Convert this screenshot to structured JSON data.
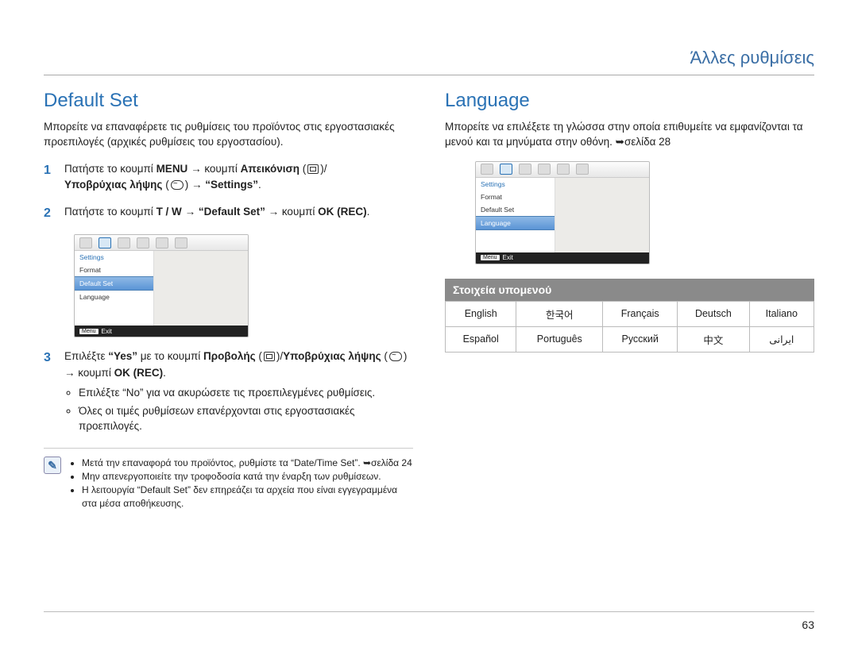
{
  "header": {
    "title": "Άλλες ρυθμίσεις"
  },
  "page_number": "63",
  "left": {
    "heading": "Default Set",
    "intro": "Μπορείτε να επαναφέρετε τις ρυθμίσεις του προϊόντος στις εργοστασιακές προεπιλογές (αρχικές ρυθμίσεις του εργοστασίου).",
    "step1_a": "Πατήστε το κουμπί ",
    "step1_menu": "MENU",
    "step1_arrow": " → κουμπί ",
    "step1_b": "Απεικόνιση",
    "step1_c": "Υποβρύχιας λήψης",
    "step1_d": " → ",
    "step1_e": "“Settings”",
    "step1_dot": ".",
    "step2_a": "Πατήστε το κουμπί ",
    "step2_tw": "T / W",
    "step2_arrow1": " → ",
    "step2_ds": "“Default Set”",
    "step2_arrow2": " → κουμπί ",
    "step2_ok": "OK (REC)",
    "step2_dot": ".",
    "device": {
      "section": "Settings",
      "items": [
        "Format",
        "Default Set",
        "Language"
      ],
      "highlight_index": 1,
      "footer_key": "Menu",
      "footer_label": "Exit"
    },
    "step3_a": "Επιλέξτε ",
    "step3_yes": "“Yes”",
    "step3_b": " με το κουμπί ",
    "step3_c": "Προβολής",
    "step3_d": "Υποβρύχιας λήψης",
    "step3_e": " → κουμπί ",
    "step3_ok": "OK (REC)",
    "step3_dot": ".",
    "bullets": [
      "Επιλέξτε “No” για να ακυρώσετε τις προεπιλεγμένες ρυθμίσεις.",
      "Όλες οι τιμές ρυθμίσεων επανέρχονται στις εργοστασιακές προεπιλογές."
    ],
    "note": {
      "items": [
        "Μετά την επαναφορά του προϊόντος, ρυθμίστε τα “Date/Time Set”. ➥σελίδα 24",
        "Μην απενεργοποιείτε την τροφοδοσία κατά την έναρξη των ρυθμίσεων.",
        "Η λειτουργία “Default Set” δεν επηρεάζει τα αρχεία που είναι εγγεγραμμένα στα μέσα αποθήκευσης."
      ]
    }
  },
  "right": {
    "heading": "Language",
    "intro": "Μπορείτε να επιλέξετε τη γλώσσα στην οποία επιθυμείτε να εμφανίζονται τα μενού και τα μηνύματα στην οθόνη. ➥σελίδα 28",
    "device": {
      "section": "Settings",
      "items": [
        "Format",
        "Default Set",
        "Language"
      ],
      "highlight_index": 2,
      "footer_key": "Menu",
      "footer_label": "Exit"
    },
    "submenu_title": "Στοιχεία υπομενού",
    "languages": [
      [
        "English",
        "한국어",
        "Français",
        "Deutsch",
        "Italiano"
      ],
      [
        "Español",
        "Português",
        "Русский",
        "中文",
        "ایرانی"
      ]
    ]
  }
}
